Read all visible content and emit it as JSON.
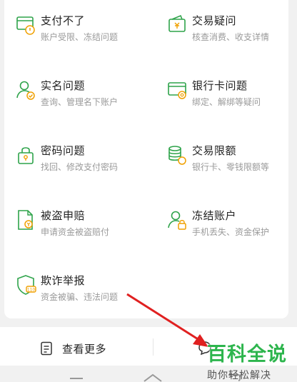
{
  "items": [
    {
      "title": "支付不了",
      "sub": "账户受限、冻结问题",
      "icon": "card-lock-icon"
    },
    {
      "title": "交易疑问",
      "sub": "核查消费、收支详情",
      "icon": "wallet-yen-icon"
    },
    {
      "title": "实名问题",
      "sub": "查询、管理名下账户",
      "icon": "user-check-icon"
    },
    {
      "title": "银行卡问题",
      "sub": "绑定、解绑等疑问",
      "icon": "bank-card-gear-icon"
    },
    {
      "title": "密码问题",
      "sub": "找回、修改支付密码",
      "icon": "padlock-icon"
    },
    {
      "title": "交易限额",
      "sub": "银行卡、零钱限额等",
      "icon": "coin-stack-icon"
    },
    {
      "title": "被盗申赔",
      "sub": "申请资金被盗赔付",
      "icon": "document-yen-icon"
    },
    {
      "title": "冻结账户",
      "sub": "手机丢失、资金保护",
      "icon": "user-lock-icon"
    },
    {
      "title": "欺诈举报",
      "sub": "资金被骗、违法问题",
      "icon": "shield-report-icon"
    }
  ],
  "bottom": {
    "more_label": "查看更多"
  },
  "watermark": {
    "brand": "百科全说",
    "slogan": "助你轻松解决"
  },
  "colors": {
    "accent": "#2ea34a",
    "arrow": "#e02020"
  }
}
